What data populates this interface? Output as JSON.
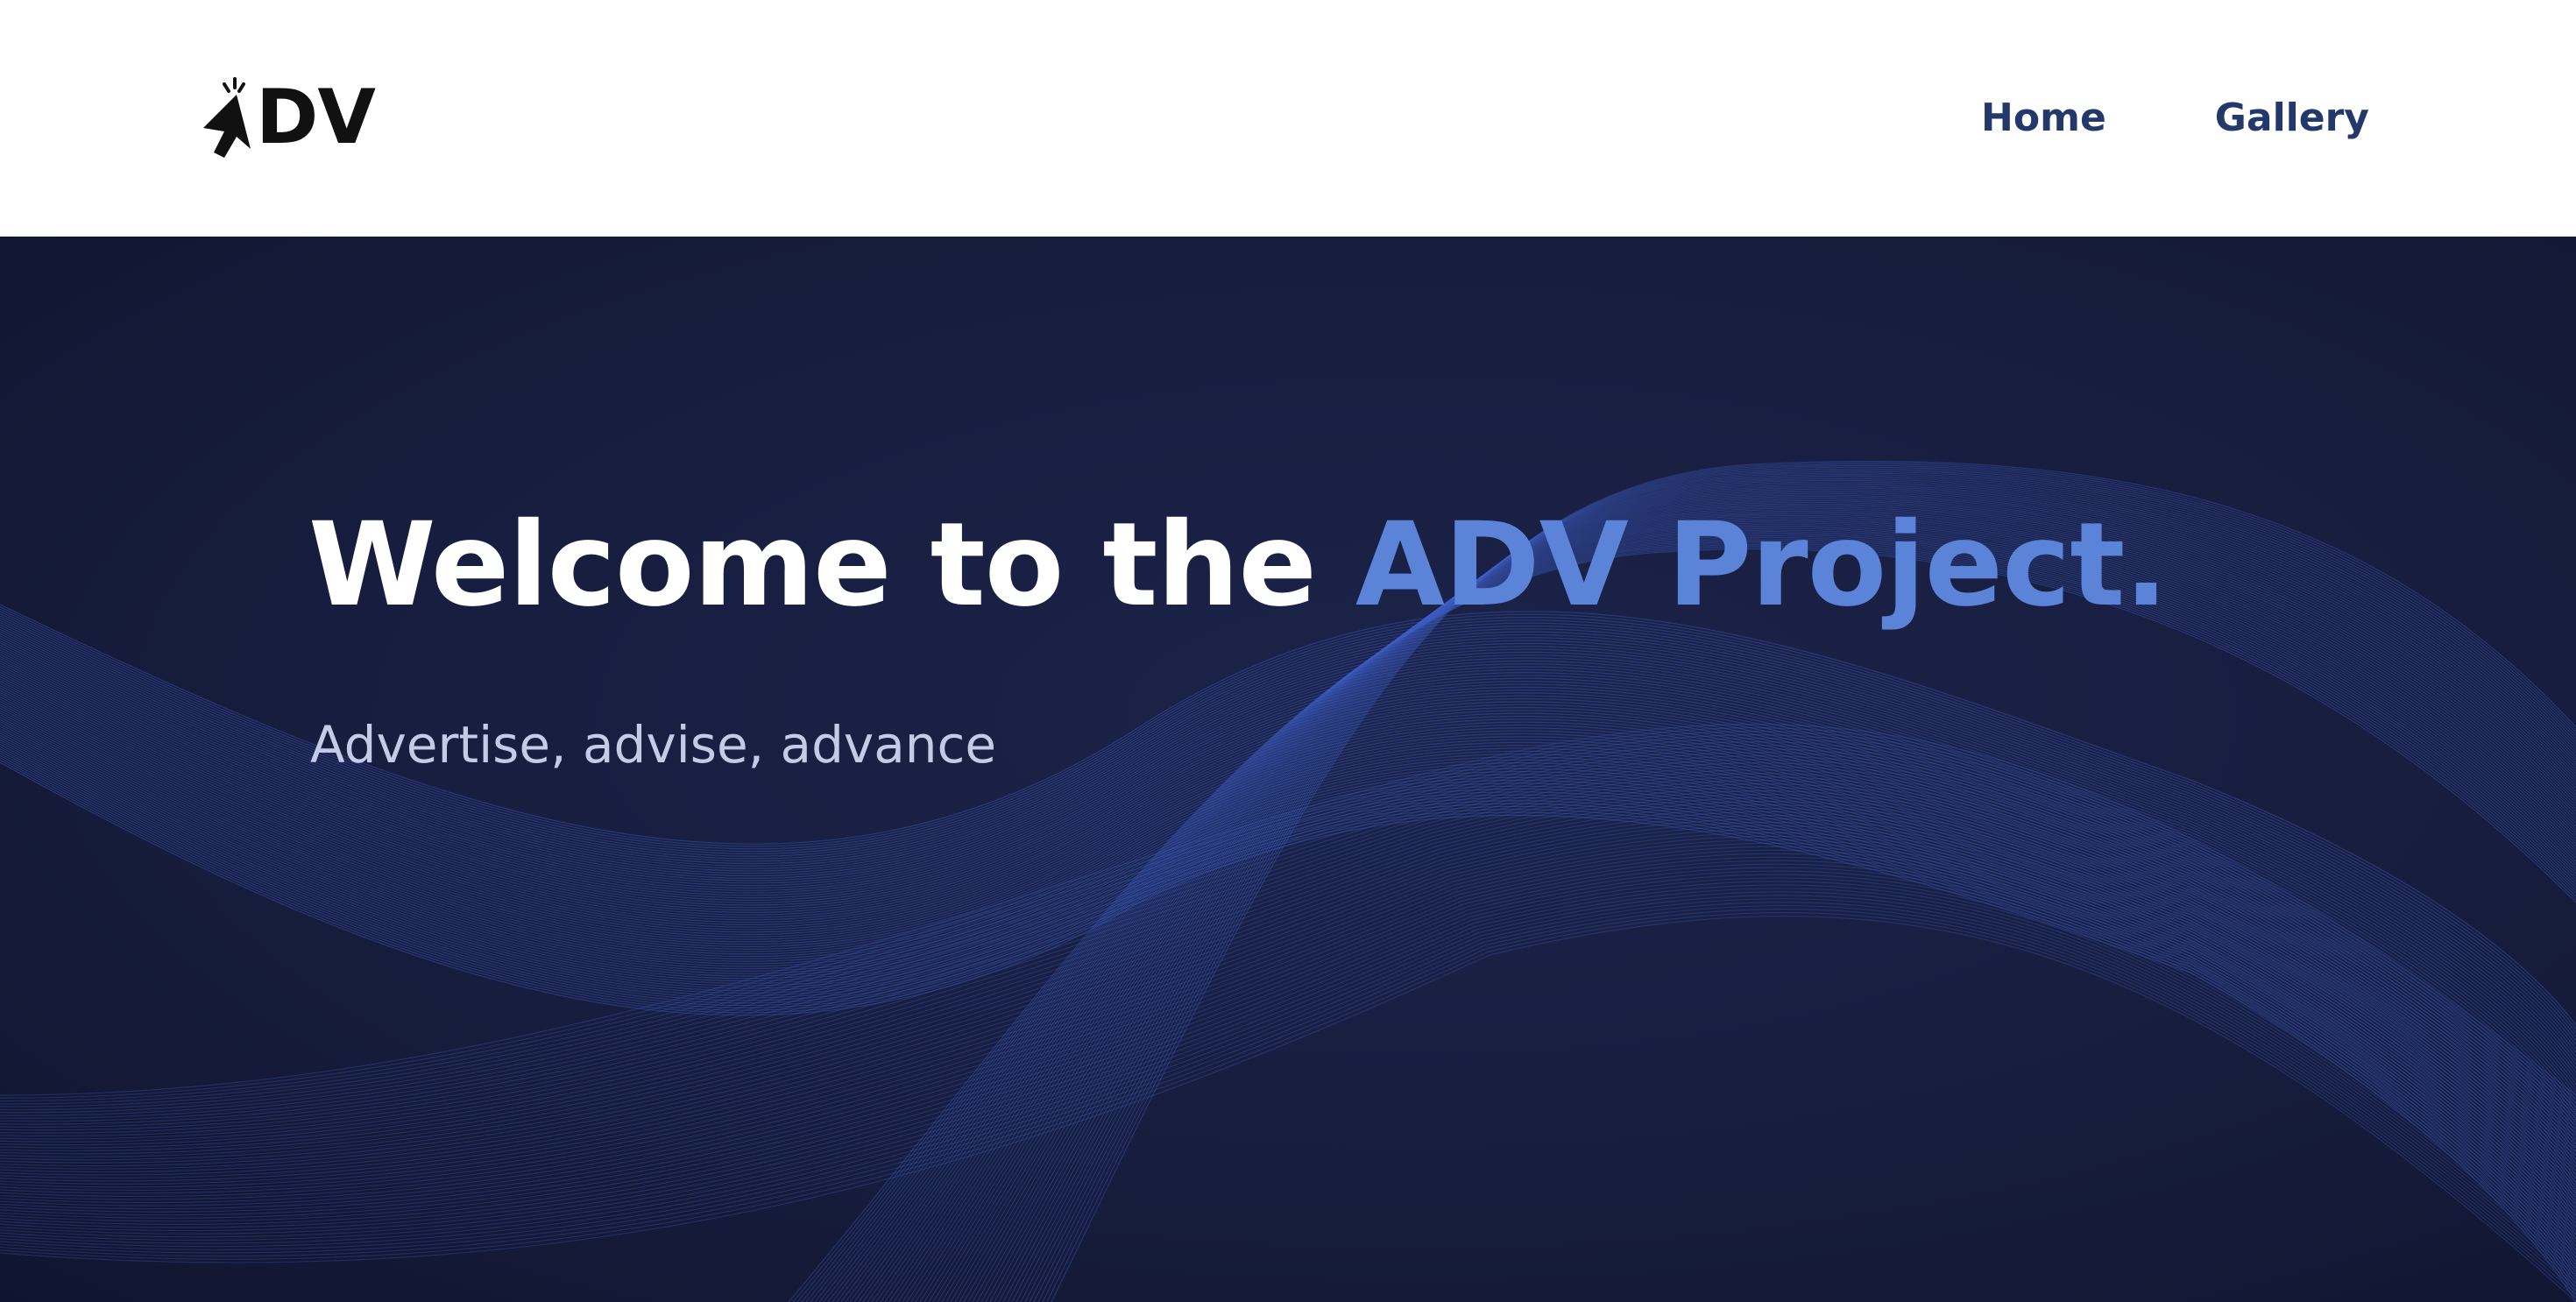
{
  "header": {
    "logo_text": "DV",
    "logo_icon": "cursor-click-icon",
    "nav": [
      {
        "label": "Home"
      },
      {
        "label": "Gallery"
      }
    ]
  },
  "hero": {
    "title_main": "Welcome to the ",
    "title_accent": "ADV Project.",
    "subtitle": "Advertise, advise, advance"
  },
  "colors": {
    "nav_text": "#23396b",
    "hero_background": "#171d3e",
    "accent": "#5b84d8",
    "wave_lines": "#3f5fc4",
    "subtitle": "#c3cbe6"
  }
}
